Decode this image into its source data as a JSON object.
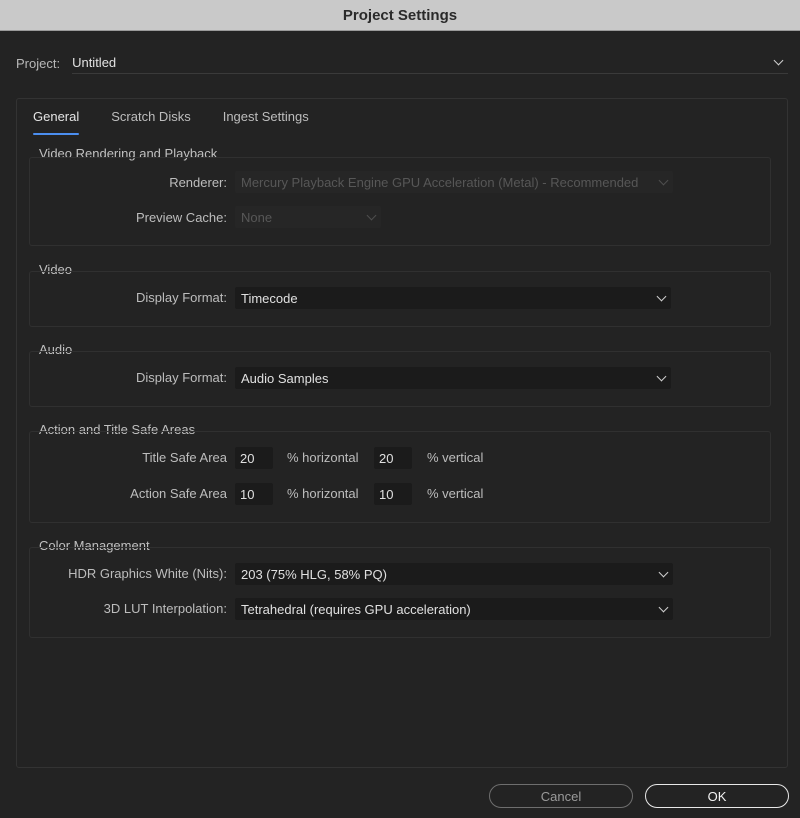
{
  "window": {
    "title": "Project Settings"
  },
  "project": {
    "label": "Project:",
    "value": "Untitled"
  },
  "tabs": [
    {
      "label": "General",
      "active": true
    },
    {
      "label": "Scratch Disks",
      "active": false
    },
    {
      "label": "Ingest Settings",
      "active": false
    }
  ],
  "video_rendering": {
    "title": "Video Rendering and Playback",
    "renderer_label": "Renderer:",
    "renderer_value": "Mercury Playback Engine GPU Acceleration (Metal) - Recommended",
    "preview_cache_label": "Preview Cache:",
    "preview_cache_value": "None"
  },
  "video": {
    "title": "Video",
    "display_format_label": "Display Format:",
    "display_format_value": "Timecode"
  },
  "audio": {
    "title": "Audio",
    "display_format_label": "Display Format:",
    "display_format_value": "Audio Samples"
  },
  "safe_areas": {
    "title": "Action and Title Safe Areas",
    "title_safe_label": "Title Safe Area",
    "title_safe_h": "20",
    "title_safe_v": "20",
    "action_safe_label": "Action Safe Area",
    "action_safe_h": "10",
    "action_safe_v": "10",
    "horizontal_unit": "% horizontal",
    "vertical_unit": "% vertical"
  },
  "color_management": {
    "title": "Color Management",
    "hdr_label": "HDR Graphics White (Nits):",
    "hdr_value": "203 (75% HLG, 58% PQ)",
    "lut_label": "3D LUT Interpolation:",
    "lut_value": "Tetrahedral (requires GPU acceleration)"
  },
  "buttons": {
    "cancel": "Cancel",
    "ok": "OK"
  },
  "colors": {
    "accent": "#4b8ef0",
    "background": "#232323",
    "titlebar": "#c9c9c9"
  }
}
